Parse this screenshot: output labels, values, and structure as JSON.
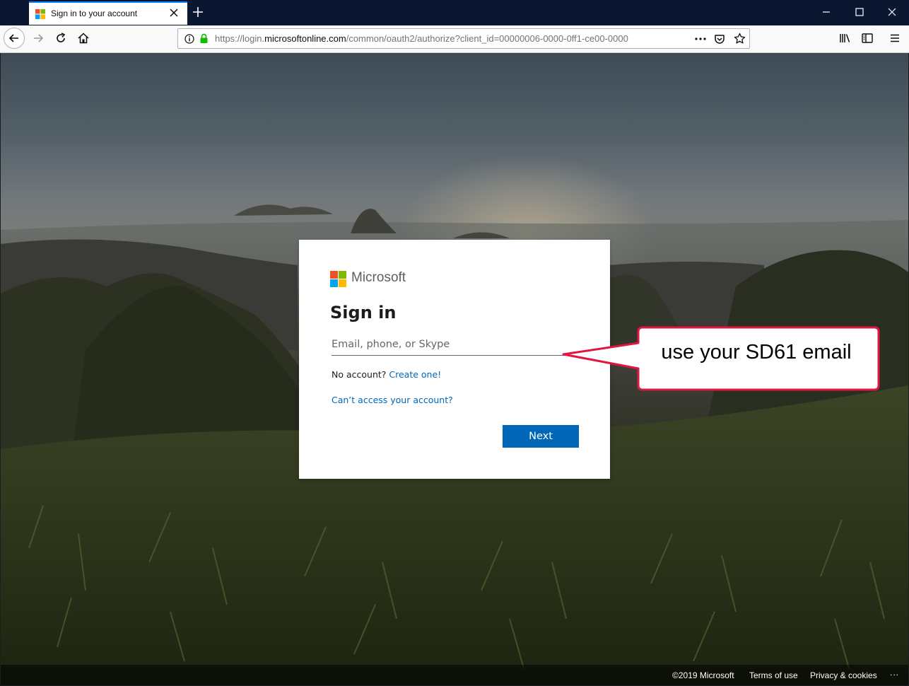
{
  "browser": {
    "tab": {
      "title": "Sign in to your account"
    },
    "url": {
      "scheme": "https://login.",
      "domain": "microsoftonline.com",
      "path": "/common/oauth2/authorize?client_id=00000006-0000-0ff1-ce00-0000"
    },
    "icons": [
      "microsoft-favicon",
      "close-icon",
      "plus-icon",
      "minimize-icon",
      "maximize-icon",
      "window-close-icon",
      "back-arrow-icon",
      "forward-arrow-icon",
      "reload-icon",
      "home-icon",
      "info-icon",
      "lock-icon",
      "more-icon",
      "pocket-icon",
      "star-icon",
      "library-icon",
      "sidebar-icon",
      "menu-icon"
    ]
  },
  "signin": {
    "brand": "Microsoft",
    "title": "Sign in",
    "email_placeholder": "Email, phone, or Skype",
    "no_account": "No account?",
    "create_link": "Create one!",
    "cant_access": "Can’t access your account?",
    "next": "Next"
  },
  "callout": {
    "text": "use your SD61 email"
  },
  "footer": {
    "copyright": "©2019 Microsoft",
    "terms": "Terms of use",
    "privacy": "Privacy & cookies",
    "more": "..."
  },
  "colors": {
    "accent": "#0067b8",
    "callout_border": "#e0163f",
    "titlebar": "#0b1730"
  }
}
